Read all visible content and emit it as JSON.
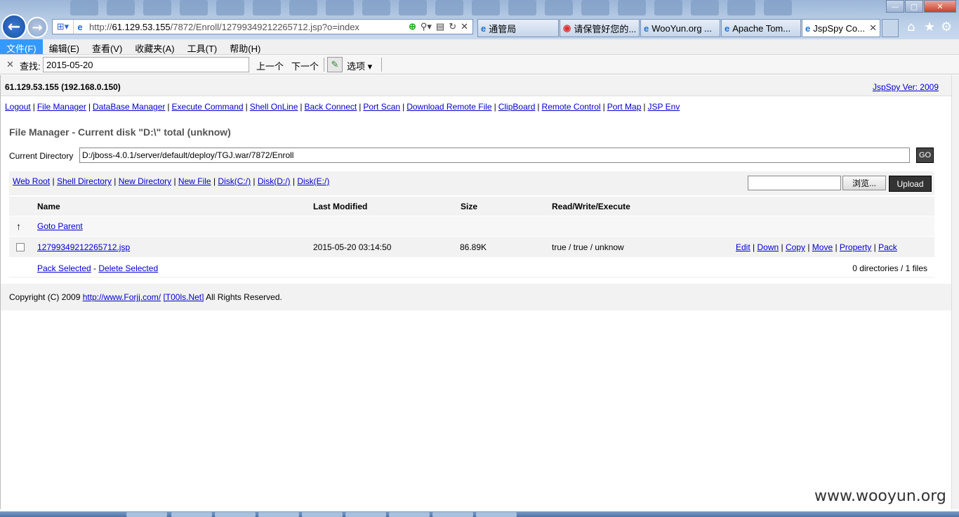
{
  "browser": {
    "url_prefix": "http://",
    "url_host": "61.129.53.155",
    "url_path": "/7872/Enroll/12799349212265712.jsp?o=index",
    "tabs": [
      {
        "label": "通管局"
      },
      {
        "label": "请保管好您的..."
      },
      {
        "label": "WooYun.org ..."
      },
      {
        "label": "Apache Tom..."
      },
      {
        "label": "JspSpy Co..."
      }
    ],
    "window_controls": {
      "minimize": "—",
      "restore": "▢",
      "close": "✕"
    }
  },
  "menu": [
    "文件(F)",
    "编辑(E)",
    "查看(V)",
    "收藏夹(A)",
    "工具(T)",
    "帮助(H)"
  ],
  "findbar": {
    "close": "✕",
    "label": "查找:",
    "value": "2015-05-20",
    "prev": "上一个",
    "next": "下一个",
    "options": "选项 ▾"
  },
  "page": {
    "host": "61.129.53.155 (192.168.0.150)",
    "version_link": "JspSpy Ver: 2009",
    "nav_links": [
      "Logout",
      "File Manager",
      "DataBase Manager",
      "Execute Command",
      "Shell OnLine",
      "Back Connect",
      "Port Scan",
      "Download Remote File",
      "ClipBoard",
      "Remote Control",
      "Port Map",
      "JSP Env"
    ],
    "title": "File Manager - Current disk \"D:\\\" total (unknow)",
    "current_dir_label": "Current Directory",
    "current_dir": "D:/jboss-4.0.1/server/default/deploy/TGJ.war/7872/Enroll",
    "go_label": "GO",
    "tool_links": [
      "Web Root",
      "Shell Directory",
      "New Directory",
      "New File",
      "Disk(C:/)",
      "Disk(D:/)",
      "Disk(E:/)"
    ],
    "browse_label": "浏览...",
    "upload_label": "Upload",
    "columns": [
      "Name",
      "Last Modified",
      "Size",
      "Read/Write/Execute"
    ],
    "parent_link": "Goto Parent",
    "up_arrow": "↑",
    "file": {
      "name": "12799349212265712.jsp",
      "modified": "2015-05-20 03:14:50",
      "size": "86.89K",
      "rwx": "true / true / unknow",
      "actions": [
        "Edit",
        "Down",
        "Copy",
        "Move",
        "Property",
        "Pack"
      ]
    },
    "pack_selected": "Pack Selected",
    "delete_selected": "Delete Selected",
    "summary": "0 directories / 1 files",
    "copyright_prefix": "Copyright (C) 2009",
    "copyright_link1": "http://www.Forjj.com/",
    "copyright_link2": "[T00ls.Net]",
    "copyright_suffix": "All Rights Reserved."
  },
  "watermark": "www.wooyun.org"
}
